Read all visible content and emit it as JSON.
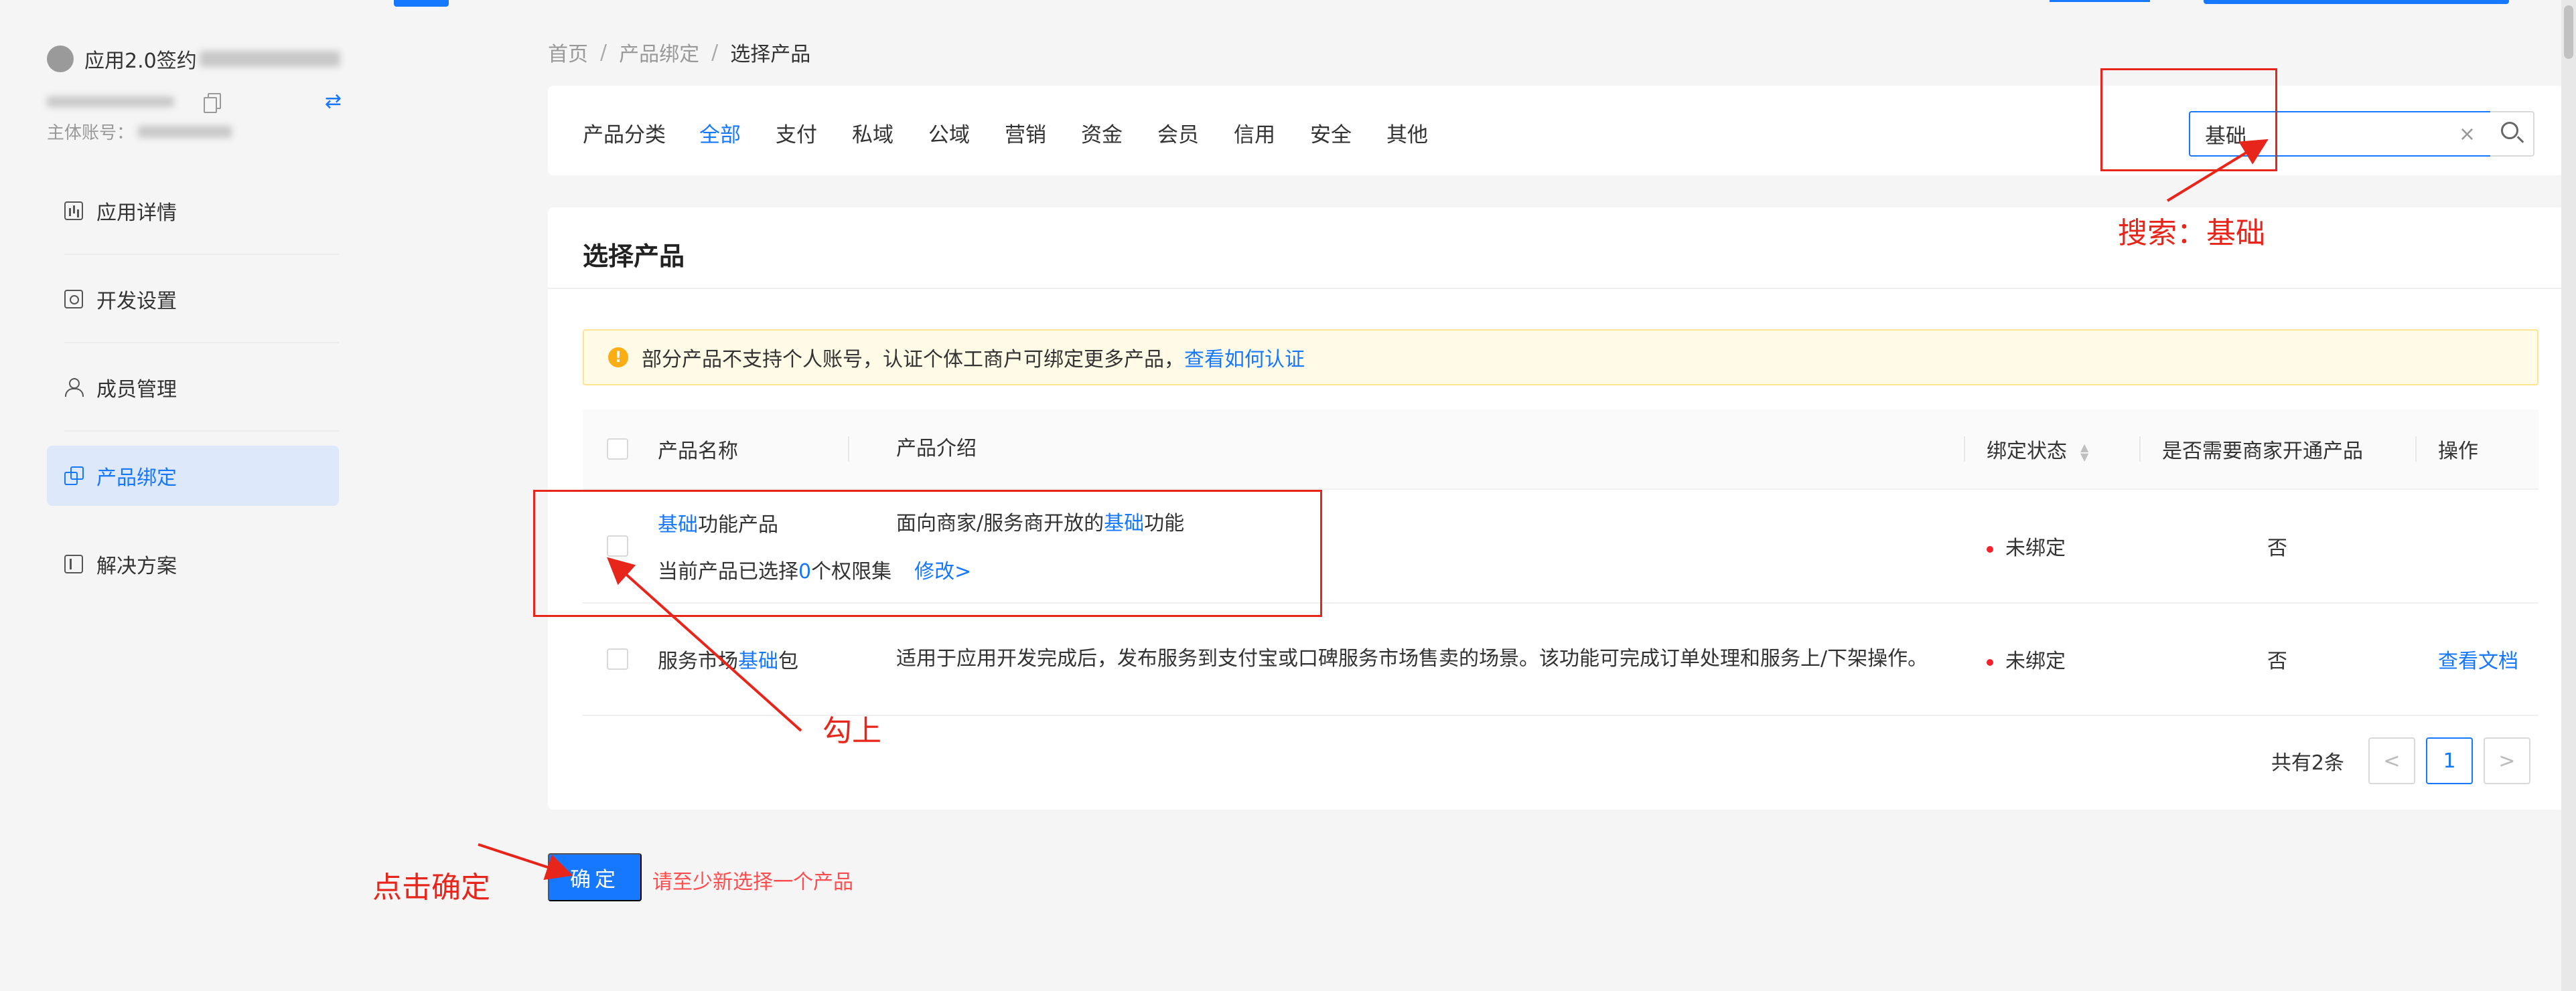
{
  "sidebar": {
    "app_name": "应用2.0签约",
    "account_label": "主体账号：",
    "swap_symbol": "⇄",
    "menu": [
      {
        "label": "应用详情"
      },
      {
        "label": "开发设置"
      },
      {
        "label": "成员管理"
      },
      {
        "label": "产品绑定"
      },
      {
        "label": "解决方案"
      }
    ]
  },
  "breadcrumb": [
    "首页",
    "产品绑定",
    "选择产品"
  ],
  "breadcrumb_sep": "/",
  "filter": {
    "label": "产品分类",
    "categories": [
      "全部",
      "支付",
      "私域",
      "公域",
      "营销",
      "资金",
      "会员",
      "信用",
      "安全",
      "其他"
    ],
    "active": "全部",
    "search_value": "基础",
    "clear_symbol": "×"
  },
  "card": {
    "title": "选择产品",
    "alert_text": "部分产品不支持个人账号，认证个体工商户可绑定更多产品，",
    "alert_link": "查看如何认证",
    "alert_icon": "!"
  },
  "table": {
    "headers": {
      "name": "产品名称",
      "desc": "产品介绍",
      "status": "绑定状态",
      "need": "是否需要商家开通产品",
      "op": "操作"
    },
    "rows": [
      {
        "name_hl": "基础",
        "name_rest": "功能产品",
        "desc_pre": "面向商家/服务商开放的",
        "desc_hl": "基础",
        "desc_post": "功能",
        "sub_pre": "当前产品已选择",
        "sub_count": "0",
        "sub_post": "个权限集",
        "sub_edit": "修改>",
        "status": "未绑定",
        "need": "否",
        "op": ""
      },
      {
        "name_pre": "服务市场",
        "name_hl": "基础",
        "name_post": "包",
        "desc": "适用于应用开发完成后，发布服务到支付宝或口碑服务市场售卖的场景。该功能可完成订单处理和服务上/下架操作。",
        "status": "未绑定",
        "need": "否",
        "op": "查看文档"
      }
    ]
  },
  "pagination": {
    "total": "共有2条",
    "prev": "<",
    "current": "1",
    "next": ">"
  },
  "footer": {
    "confirm_label": "确定",
    "hint": "请至少新选择一个产品"
  },
  "annotations": {
    "search_note": "搜索：基础",
    "check_note": "勾上",
    "click_note": "点击确定",
    "color": "#e8251a"
  },
  "colors": {
    "accent": "#1677ff",
    "warning_bg": "#fffbe6",
    "status_dot": "#f5222d",
    "hint": "#ff4d4f"
  }
}
